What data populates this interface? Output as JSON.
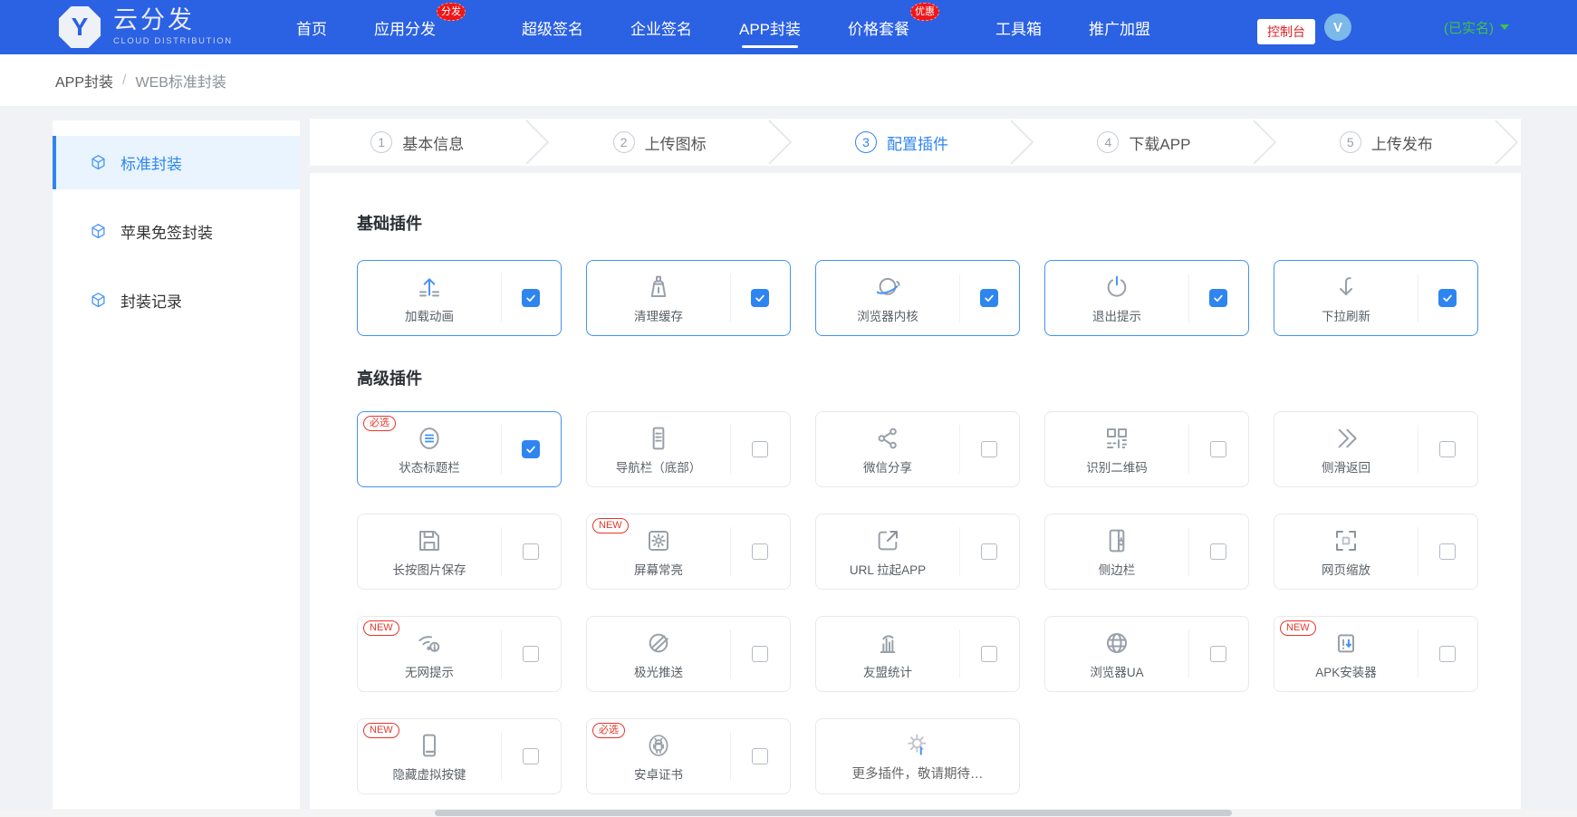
{
  "nav": {
    "logo": {
      "initial": "Y",
      "title": "云分发",
      "subtitle": "CLOUD DISTRIBUTION"
    },
    "items": [
      {
        "label": "首页"
      },
      {
        "label": "应用分发",
        "badge": "分发"
      },
      {
        "label": "超级签名"
      },
      {
        "label": "企业签名"
      },
      {
        "label": "APP封装"
      },
      {
        "label": "价格套餐",
        "badge": "优惠"
      },
      {
        "label": "工具箱"
      },
      {
        "label": "推广加盟"
      }
    ],
    "console_button": "控制台",
    "avatar_initial": "V",
    "verified": "(已实名)"
  },
  "breadcrumb": {
    "section": "APP封装",
    "separator": "/",
    "page": "WEB标准封装"
  },
  "sidebar": {
    "items": [
      {
        "label": "标准封装"
      },
      {
        "label": "苹果免签封装"
      },
      {
        "label": "封装记录"
      }
    ]
  },
  "steps": [
    {
      "num": "1",
      "label": "基本信息"
    },
    {
      "num": "2",
      "label": "上传图标"
    },
    {
      "num": "3",
      "label": "配置插件"
    },
    {
      "num": "4",
      "label": "下载APP"
    },
    {
      "num": "5",
      "label": "上传发布"
    }
  ],
  "sections": {
    "basic": {
      "title": "基础插件",
      "plugins": [
        {
          "label": "加载动画",
          "checked": true
        },
        {
          "label": "清理缓存",
          "checked": true
        },
        {
          "label": "浏览器内核",
          "checked": true
        },
        {
          "label": "退出提示",
          "checked": true
        },
        {
          "label": "下拉刷新",
          "checked": true
        }
      ]
    },
    "advanced": {
      "title": "高级插件",
      "plugins": [
        {
          "label": "状态标题栏",
          "badge": "必选",
          "checked": true
        },
        {
          "label": "导航栏（底部）",
          "checked": false
        },
        {
          "label": "微信分享",
          "checked": false
        },
        {
          "label": "识别二维码",
          "checked": false
        },
        {
          "label": "侧滑返回",
          "checked": false
        },
        {
          "label": "长按图片保存",
          "checked": false
        },
        {
          "label": "屏幕常亮",
          "badge": "NEW",
          "checked": false
        },
        {
          "label": "URL 拉起APP",
          "checked": false
        },
        {
          "label": "侧边栏",
          "checked": false
        },
        {
          "label": "网页缩放",
          "checked": false
        },
        {
          "label": "无网提示",
          "badge": "NEW",
          "checked": false
        },
        {
          "label": "极光推送",
          "checked": false
        },
        {
          "label": "友盟统计",
          "checked": false
        },
        {
          "label": "浏览器UA",
          "checked": false
        },
        {
          "label": "APK安装器",
          "badge": "NEW",
          "checked": false
        },
        {
          "label": "隐藏虚拟按键",
          "badge": "NEW",
          "checked": false
        },
        {
          "label": "安卓证书",
          "badge": "必选",
          "checked": false
        },
        {
          "label": "更多插件，敬请期待…",
          "more": true
        }
      ]
    }
  },
  "colors": {
    "nav_blue": "#2b61e3",
    "accent_blue": "#2f85f0",
    "badge_red": "#ee1717",
    "verified_green": "#3fc441"
  }
}
